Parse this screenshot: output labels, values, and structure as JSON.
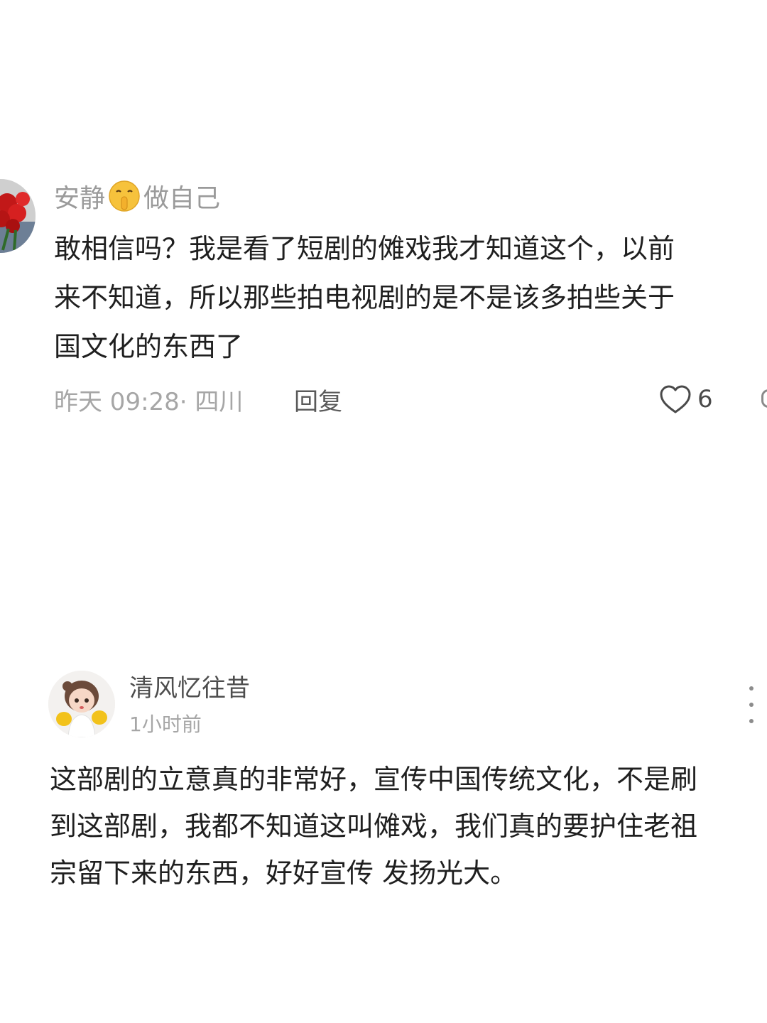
{
  "comments": [
    {
      "author": {
        "name_part1": "安静",
        "name_emoji": "shushing-face-emoji",
        "name_part2": "做自己"
      },
      "avatar": "red-roses-avatar",
      "text_lines": [
        "敢相信吗？我是看了短剧的傩戏我才知道这个，以前",
        "来不知道，所以那些拍电视剧的是不是该多拍些关于",
        "国文化的东西了"
      ],
      "meta": "昨天 09:28· 四川",
      "reply_label": "回复",
      "like_count": "6"
    },
    {
      "author": {
        "name": "清风忆往昔"
      },
      "avatar": "cartoon-girl-boxing-gloves-avatar",
      "time": "1小时前",
      "text_lines": [
        "这部剧的立意真的非常好，宣传中国传统文化，不是刷",
        "到这部剧，我都不知道这叫傩戏，我们真的要护住老祖",
        "宗留下来的东西，好好宣传 发扬光大。"
      ]
    }
  ],
  "colors": {
    "background": "#ffffff",
    "primary_text": "#1f1f1f",
    "secondary_text": "#9a9a9a"
  }
}
